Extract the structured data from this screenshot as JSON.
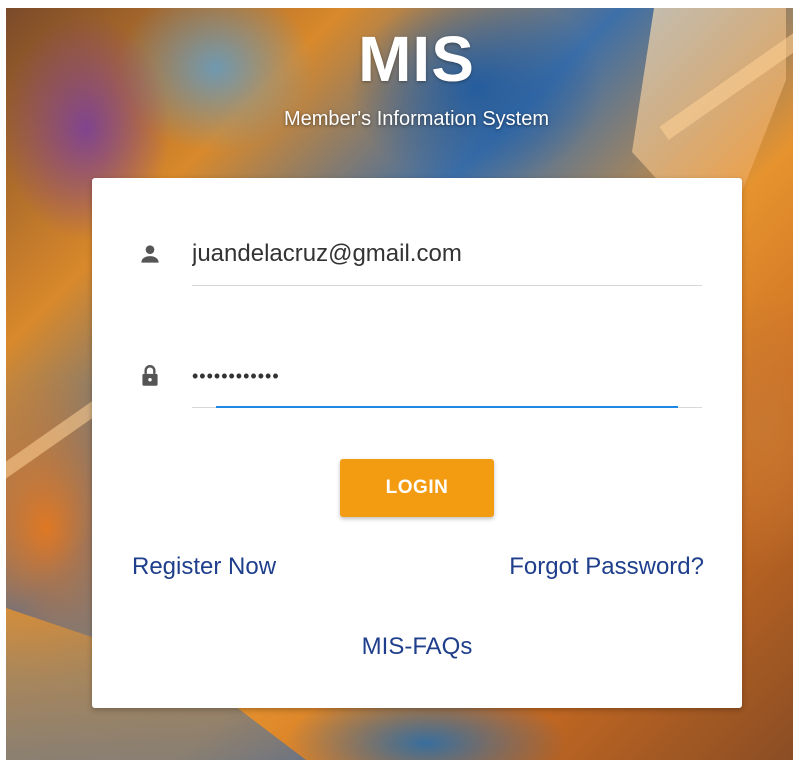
{
  "brand": {
    "title": "MIS",
    "subtitle": "Member's Information System"
  },
  "login_form": {
    "email": {
      "icon": "person-icon",
      "value": "juandelacruz@gmail.com"
    },
    "password": {
      "icon": "lock-icon",
      "value": "••••••••••••"
    },
    "login_label": "LOGIN",
    "register_label": "Register Now",
    "forgot_label": "Forgot Password?",
    "faqs_label": "MIS-FAQs"
  },
  "colors": {
    "accent_button": "#f39c12",
    "link": "#1f3f8c",
    "focus_underline": "#1e88e5",
    "icon": "#555555"
  }
}
